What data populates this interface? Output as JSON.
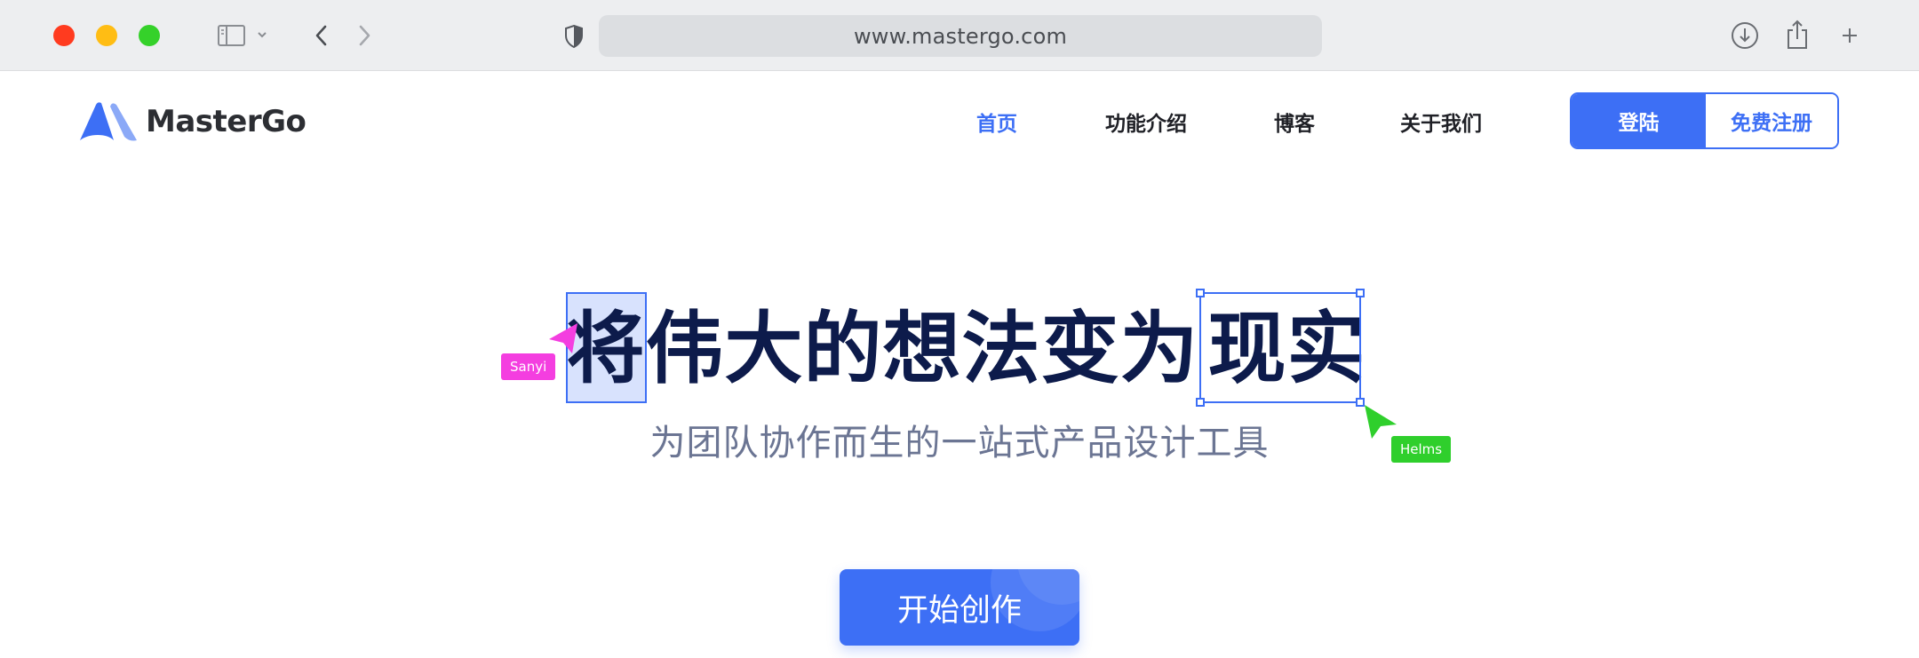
{
  "browser": {
    "url": "www.mastergo.com"
  },
  "site": {
    "logo_text": "MasterGo",
    "nav": [
      {
        "label": "首页",
        "active": true
      },
      {
        "label": "功能介绍",
        "active": false
      },
      {
        "label": "博客",
        "active": false
      },
      {
        "label": "关于我们",
        "active": false
      }
    ],
    "login_label": "登陆",
    "signup_label": "免费注册"
  },
  "hero": {
    "headline": [
      "将",
      "伟",
      "大",
      "的",
      "想",
      "法",
      "变",
      "为",
      "现",
      "实"
    ],
    "subtitle": "为团队协作而生的一站式产品设计工具",
    "cta_label": "开始创作"
  },
  "collaborators": [
    {
      "name": "Sanyi",
      "color": "#f43ee0"
    },
    {
      "name": "Helms",
      "color": "#2fcf2c"
    }
  ],
  "colors": {
    "brand": "#3d6ff5",
    "headline": "#0d1b4b",
    "subtitle": "#6b7593"
  }
}
